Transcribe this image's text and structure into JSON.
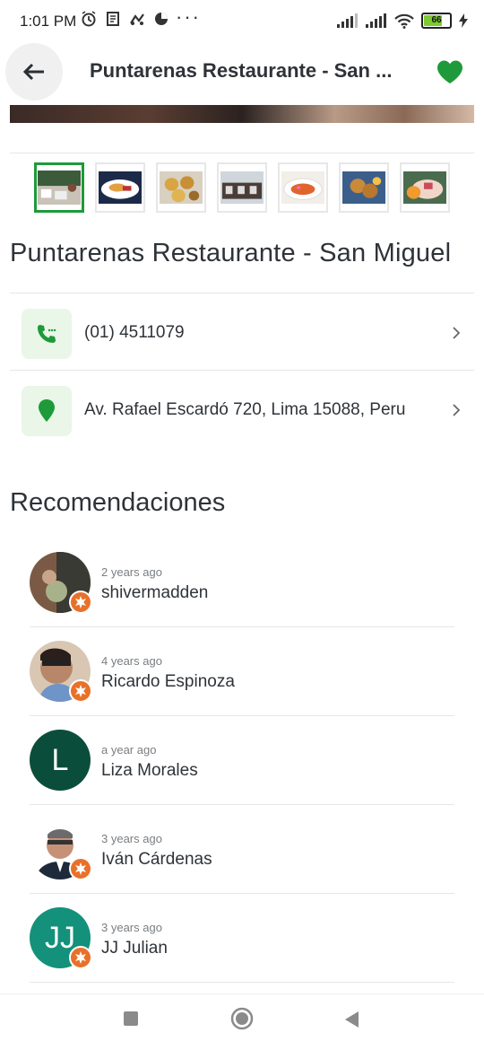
{
  "status_bar": {
    "time": "1:01 PM",
    "dots": "···",
    "battery_level": "66",
    "battery_fraction": 0.66,
    "icons": [
      "alarm-icon",
      "notes-icon",
      "app-icon",
      "pie-icon",
      "signal-icon",
      "signal-icon",
      "wifi-icon",
      "battery-icon",
      "charging-icon"
    ]
  },
  "app_bar": {
    "title": "Puntarenas Restaurante - San ...",
    "back_icon": "arrow-left-icon",
    "favorite_icon": "heart-icon",
    "accent": "#1e9a3a"
  },
  "gallery": {
    "thumbnails": [
      {
        "name": "dining-room-photo",
        "active": true
      },
      {
        "name": "dish-photo"
      },
      {
        "name": "appetizer-photo"
      },
      {
        "name": "storefront-photo"
      },
      {
        "name": "seafood-plate-photo"
      },
      {
        "name": "fried-food-photo"
      },
      {
        "name": "ceviche-photo"
      }
    ]
  },
  "place": {
    "name": "Puntarenas Restaurante - San Miguel",
    "phone": "(01) 4511079",
    "address": "Av. Rafael Escardó 720, Lima 15088, Peru"
  },
  "recommendations": {
    "title": "Recomendaciones",
    "items": [
      {
        "ago": "2 years ago",
        "name": "shivermadden",
        "avatar": "photo"
      },
      {
        "ago": "4 years ago",
        "name": "Ricardo Espinoza",
        "avatar": "photo"
      },
      {
        "ago": "a year ago",
        "name": "Liza Morales",
        "avatar_letters": "L",
        "avatar_color": "#0b4d3b"
      },
      {
        "ago": "3 years ago",
        "name": "Iván Cárdenas",
        "avatar": "photo"
      },
      {
        "ago": "3 years ago",
        "name": "JJ Julian",
        "avatar_letters": "JJ",
        "avatar_color": "#13917a"
      }
    ]
  },
  "nav": {
    "icons": [
      "recents-icon",
      "home-icon",
      "back-icon"
    ]
  }
}
